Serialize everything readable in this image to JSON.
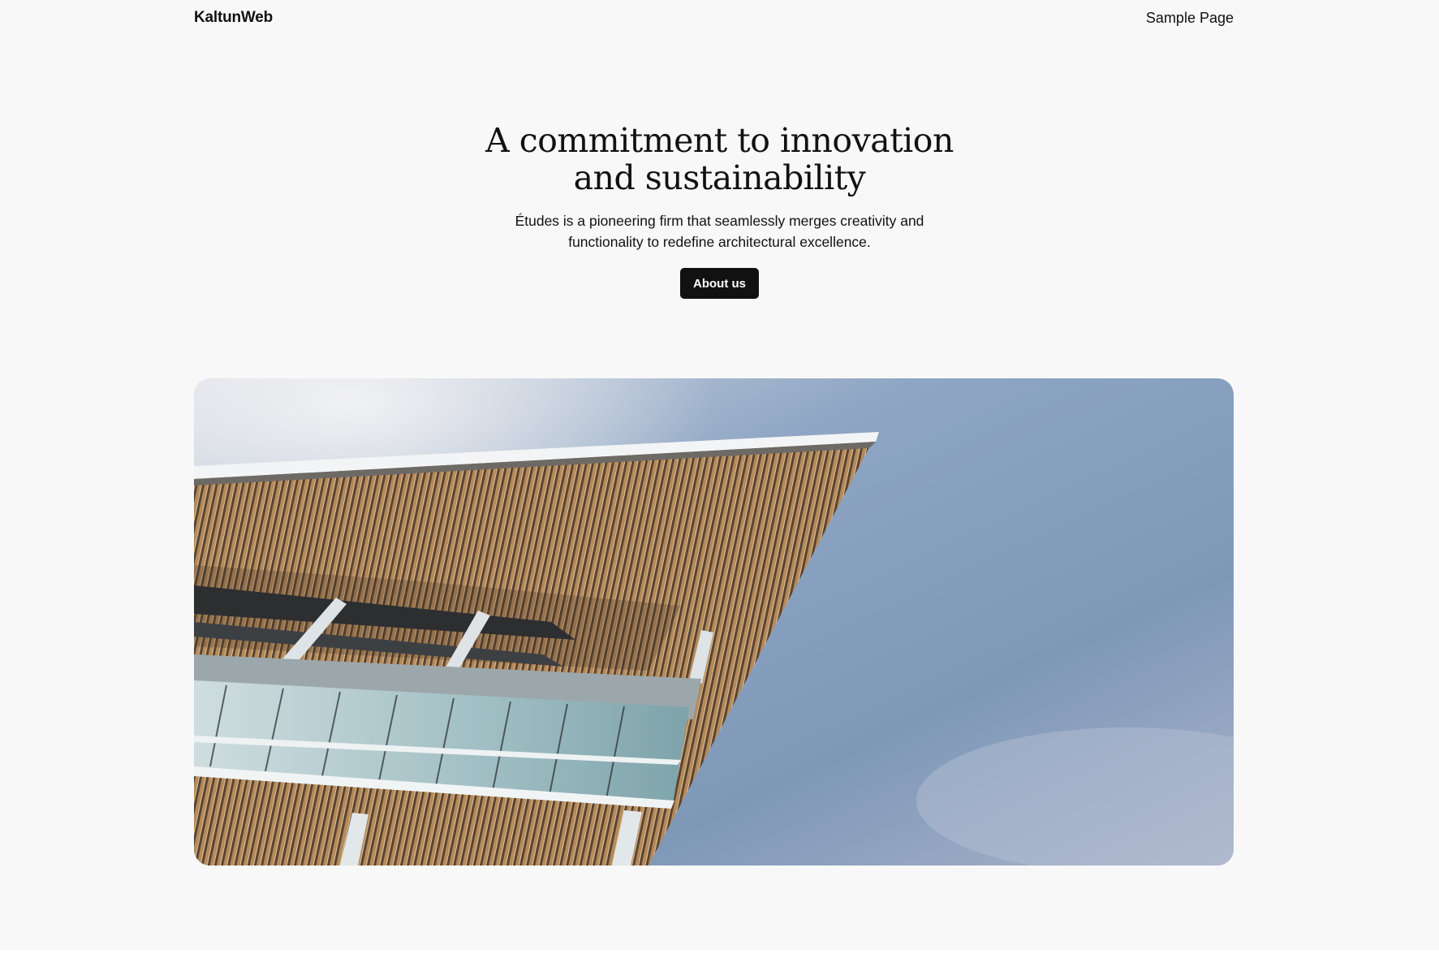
{
  "header": {
    "site_title": "KaltunWeb",
    "nav": [
      {
        "label": "Sample Page"
      }
    ]
  },
  "hero": {
    "title": "A commitment to innovation and sustainability",
    "description": "Études is a pioneering firm that seamlessly merges creativity and functionality to redefine architectural excellence.",
    "button_label": "About us"
  },
  "image": {
    "subject": "building-roof-sky-photo",
    "colors": {
      "sky_top": "#7f98b8",
      "sky_bottom": "#a9b6cc",
      "louvers": "#8a6a4a",
      "glass": "#a7c3c9",
      "steel": "#e6ecef"
    }
  }
}
